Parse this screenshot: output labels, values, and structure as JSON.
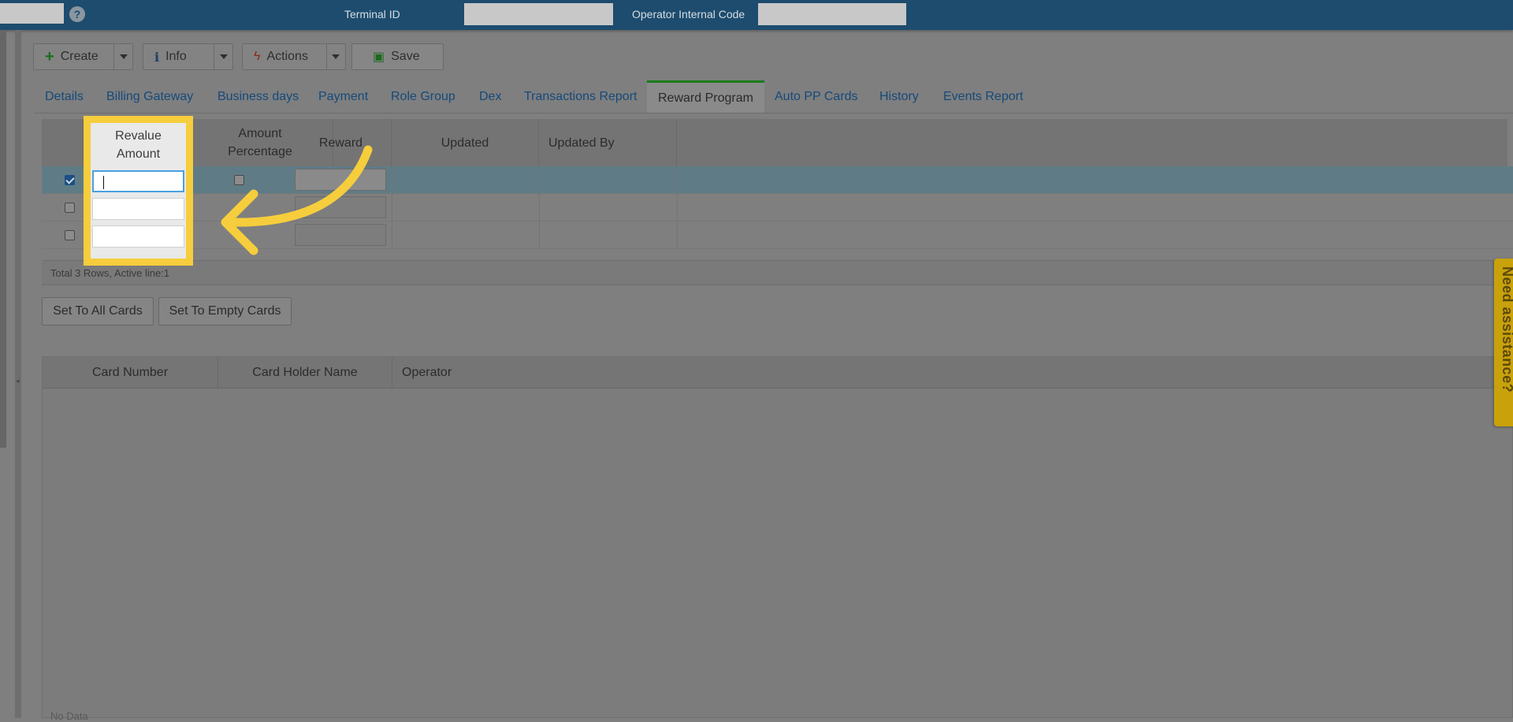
{
  "topbar": {
    "terminal_label": "Terminal ID",
    "terminal_value": "",
    "operator_code_label": "Operator Internal Code",
    "operator_code_value": "",
    "help_glyph": "?"
  },
  "toolbar": {
    "create_label": "Create",
    "info_label": "Info",
    "actions_label": "Actions",
    "save_label": "Save"
  },
  "tabs": [
    {
      "label": "Details"
    },
    {
      "label": "Billing Gateway"
    },
    {
      "label": "Business days"
    },
    {
      "label": "Payment"
    },
    {
      "label": "Role Group"
    },
    {
      "label": "Dex"
    },
    {
      "label": "Transactions Report"
    },
    {
      "label": "Reward Program",
      "active": true
    },
    {
      "label": "Auto PP Cards"
    },
    {
      "label": "History"
    },
    {
      "label": "Events Report"
    }
  ],
  "reward_grid": {
    "columns": {
      "revalue_line1": "Revalue",
      "revalue_line2": "Amount",
      "pct_line1": "Amount",
      "pct_line2": "Percentage",
      "reward": "Reward",
      "updated": "Updated",
      "updated_by": "Updated By"
    },
    "rows": [
      {
        "checked": true,
        "revalue": "",
        "percentage": false,
        "reward": ""
      },
      {
        "checked": false,
        "revalue": "",
        "percentage": false,
        "reward": ""
      },
      {
        "checked": false,
        "revalue": "",
        "percentage": false,
        "reward": ""
      }
    ],
    "footer": "Total 3 Rows, Active line:1"
  },
  "buttons": {
    "set_all": "Set To All Cards",
    "set_empty": "Set To Empty Cards"
  },
  "cards_table": {
    "columns": {
      "card_number": "Card Number",
      "holder": "Card Holder Name",
      "operator": "Operator"
    },
    "empty_text": "No Data"
  },
  "assist_tab": {
    "label": "Need assistance?"
  },
  "colors": {
    "highlight": "#f6cd3c",
    "topbar": "#1d4c6e",
    "link": "#15497a",
    "active_tab_border": "#1a7a1a"
  }
}
